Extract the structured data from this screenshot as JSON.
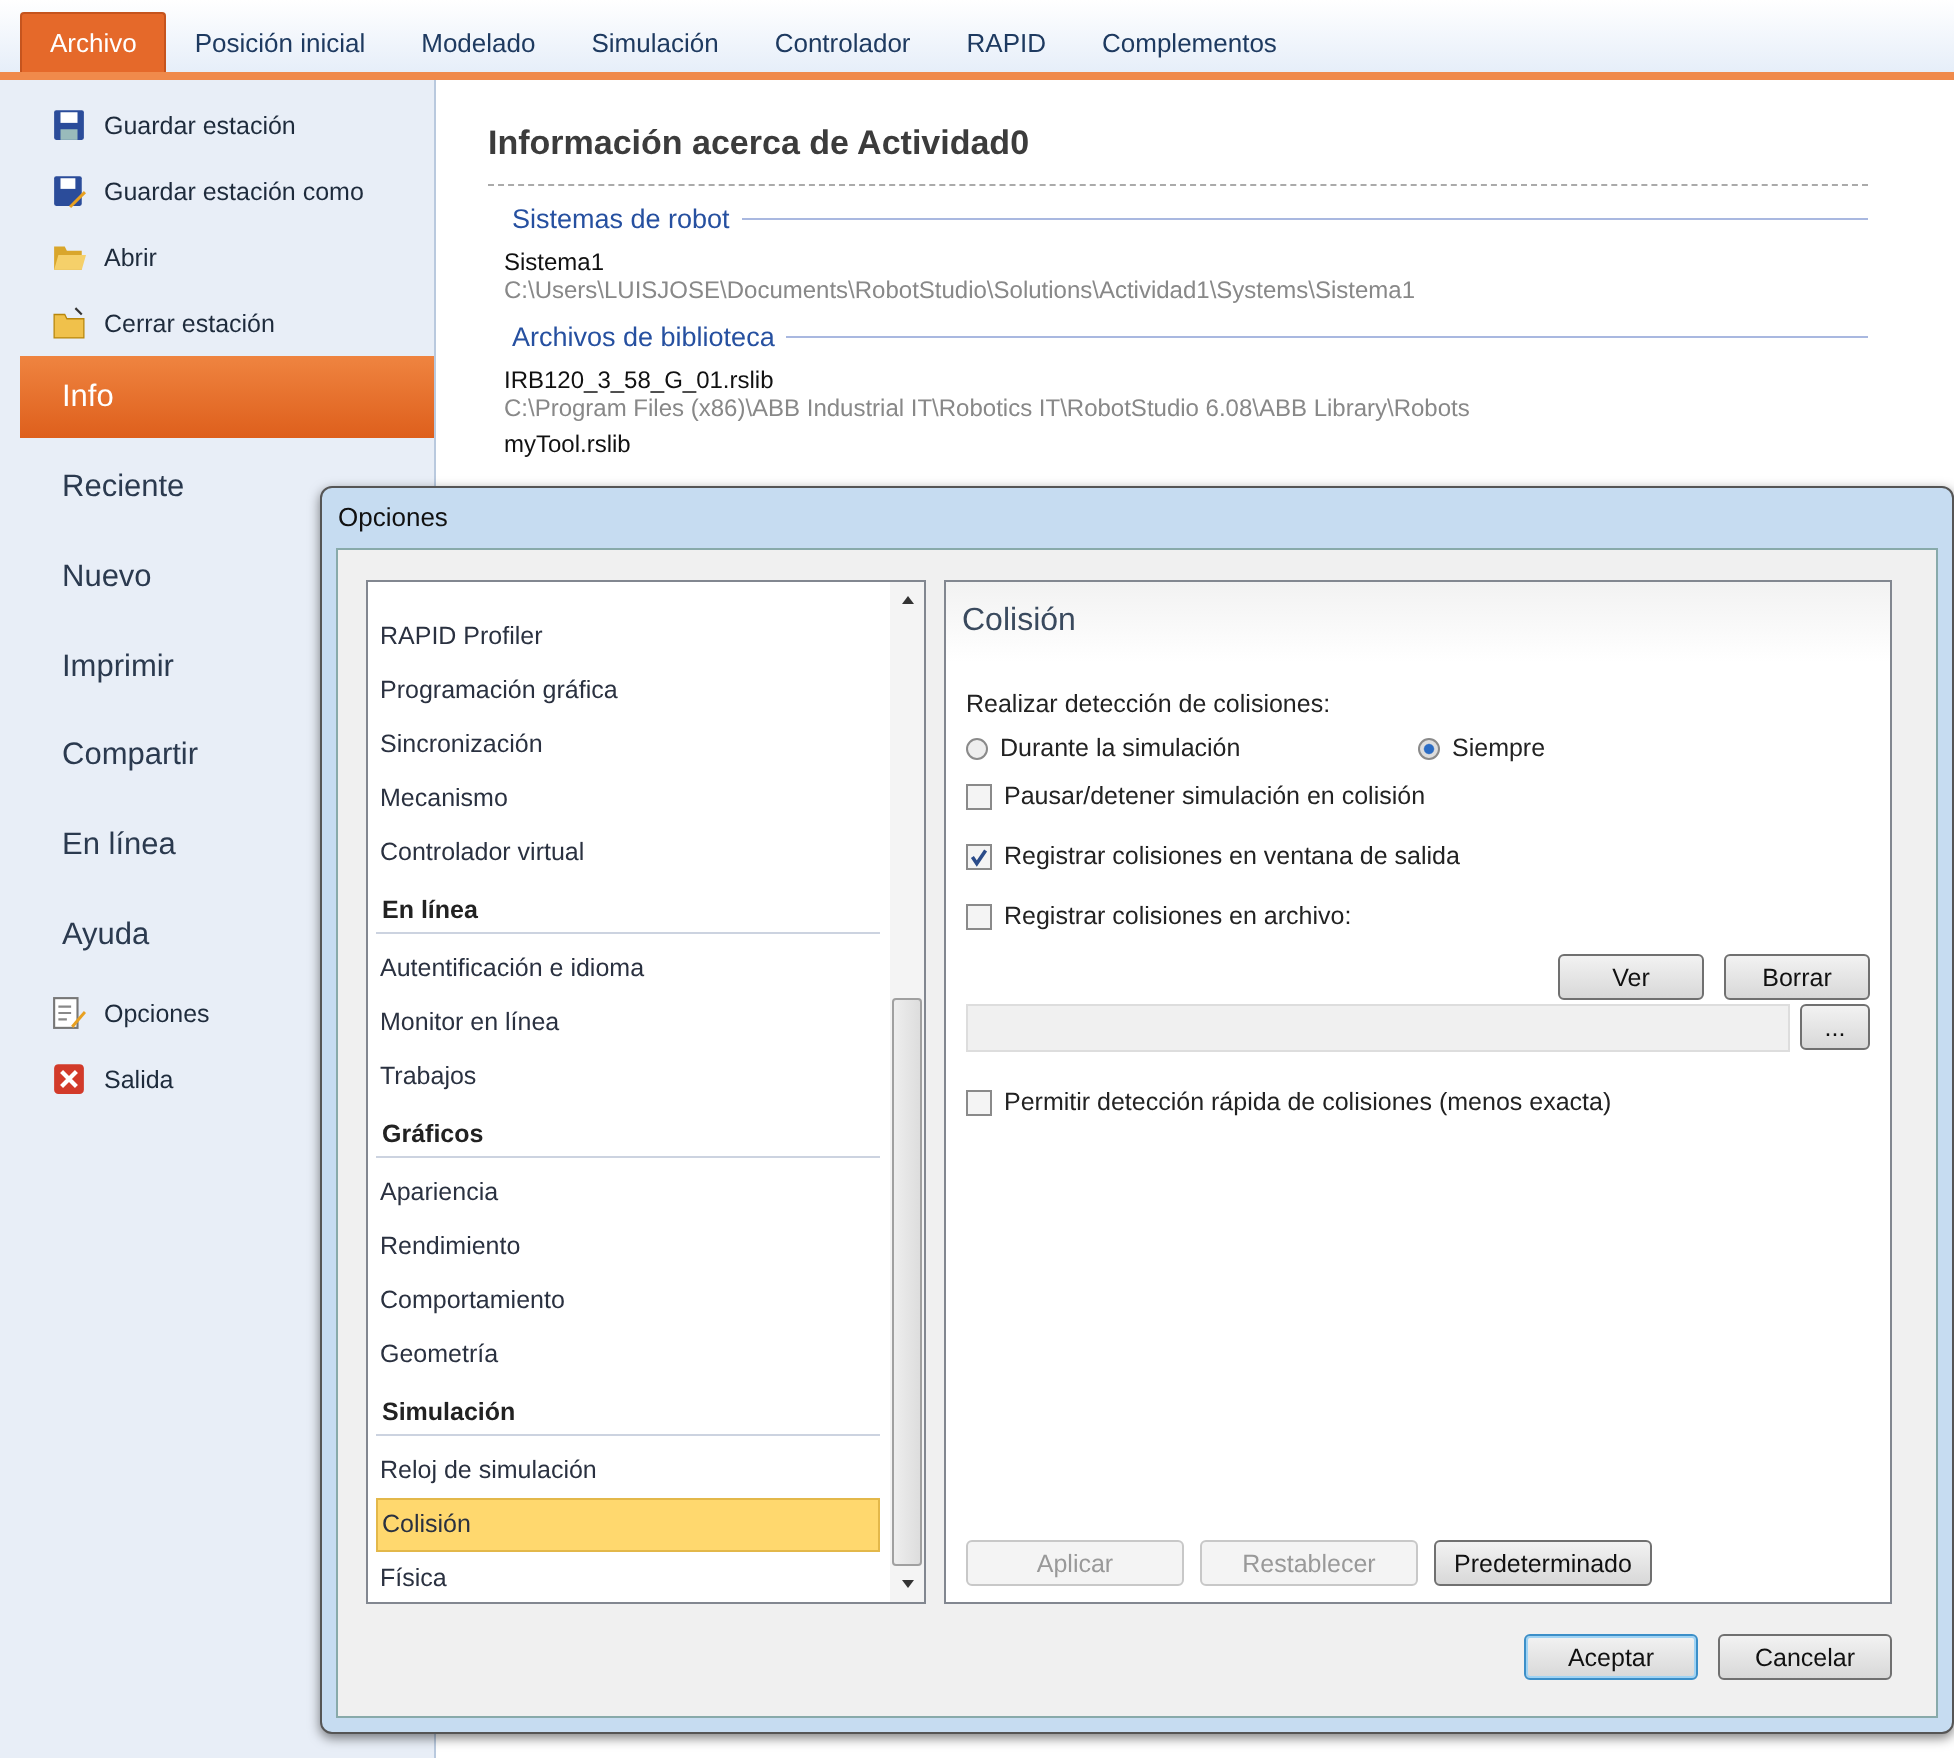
{
  "ribbon_tabs": [
    {
      "label": "Archivo",
      "selected": true
    },
    {
      "label": "Posición inicial",
      "selected": false
    },
    {
      "label": "Modelado",
      "selected": false
    },
    {
      "label": "Simulación",
      "selected": false
    },
    {
      "label": "Controlador",
      "selected": false
    },
    {
      "label": "RAPID",
      "selected": false
    },
    {
      "label": "Complementos",
      "selected": false
    }
  ],
  "sidebar": {
    "items": [
      {
        "kind": "command",
        "label": "Guardar estación"
      },
      {
        "kind": "command",
        "label": "Guardar estación como"
      },
      {
        "kind": "command",
        "label": "Abrir"
      },
      {
        "kind": "command",
        "label": "Cerrar estación"
      },
      {
        "kind": "nav",
        "label": "Info",
        "selected": true
      },
      {
        "kind": "nav",
        "label": "Reciente",
        "selected": false
      },
      {
        "kind": "nav",
        "label": "Nuevo",
        "selected": false
      },
      {
        "kind": "nav",
        "label": "Imprimir",
        "selected": false
      },
      {
        "kind": "nav",
        "label": "Compartir",
        "selected": false
      },
      {
        "kind": "nav",
        "label": "En línea",
        "selected": false
      },
      {
        "kind": "nav",
        "label": "Ayuda",
        "selected": false
      },
      {
        "kind": "command",
        "label": "Opciones"
      },
      {
        "kind": "command",
        "label": "Salida"
      }
    ]
  },
  "info": {
    "title": "Información acerca de Actividad0",
    "sections": [
      {
        "heading": "Sistemas de robot",
        "entries": [
          {
            "name": "Sistema1",
            "path": "C:\\Users\\LUISJOSE\\Documents\\RobotStudio\\Solutions\\Actividad1\\Systems\\Sistema1"
          }
        ]
      },
      {
        "heading": "Archivos de biblioteca",
        "entries": [
          {
            "name": "IRB120_3_58_G_01.rslib",
            "path": "C:\\Program Files (x86)\\ABB Industrial IT\\Robotics IT\\RobotStudio 6.08\\ABB Library\\Robots"
          },
          {
            "name": "myTool.rslib"
          }
        ]
      }
    ]
  },
  "dialog": {
    "title": "Opciones",
    "list": [
      {
        "kind": "item",
        "label": "RAPID Profiler",
        "selected": false
      },
      {
        "kind": "item",
        "label": "Programación gráfica",
        "selected": false
      },
      {
        "kind": "item",
        "label": "Sincronización",
        "selected": false
      },
      {
        "kind": "item",
        "label": "Mecanismo",
        "selected": false
      },
      {
        "kind": "item",
        "label": "Controlador virtual",
        "selected": false
      },
      {
        "kind": "header",
        "label": "En línea"
      },
      {
        "kind": "item",
        "label": "Autentificación e idioma",
        "selected": false
      },
      {
        "kind": "item",
        "label": "Monitor en línea",
        "selected": false
      },
      {
        "kind": "item",
        "label": "Trabajos",
        "selected": false
      },
      {
        "kind": "header",
        "label": "Gráficos"
      },
      {
        "kind": "item",
        "label": "Apariencia",
        "selected": false
      },
      {
        "kind": "item",
        "label": "Rendimiento",
        "selected": false
      },
      {
        "kind": "item",
        "label": "Comportamiento",
        "selected": false
      },
      {
        "kind": "item",
        "label": "Geometría",
        "selected": false
      },
      {
        "kind": "header",
        "label": "Simulación"
      },
      {
        "kind": "item",
        "label": "Reloj de simulación",
        "selected": false
      },
      {
        "kind": "item",
        "label": "Colisión",
        "selected": true
      },
      {
        "kind": "item",
        "label": "Física",
        "selected": false
      }
    ],
    "panel": {
      "title": "Colisión",
      "prompt": "Realizar detección de colisiones:",
      "radios": [
        {
          "label": "Durante la simulación",
          "selected": false
        },
        {
          "label": "Siempre",
          "selected": true
        }
      ],
      "checkboxes": [
        {
          "label": "Pausar/detener simulación en colisión",
          "checked": false
        },
        {
          "label": "Registrar colisiones en ventana de salida",
          "checked": true
        },
        {
          "label": "Registrar colisiones en archivo:",
          "checked": false
        }
      ],
      "file_buttons": [
        "Ver",
        "Borrar"
      ],
      "browse_button": "...",
      "fast_check": {
        "label": "Permitir detección rápida de colisiones (menos exacta)",
        "checked": false
      },
      "actions": [
        {
          "label": "Aplicar",
          "disabled": true
        },
        {
          "label": "Restablecer",
          "disabled": true
        },
        {
          "label": "Predeterminado",
          "disabled": false
        }
      ]
    },
    "buttons": [
      {
        "label": "Aceptar",
        "default": true
      },
      {
        "label": "Cancelar",
        "default": false
      }
    ]
  }
}
